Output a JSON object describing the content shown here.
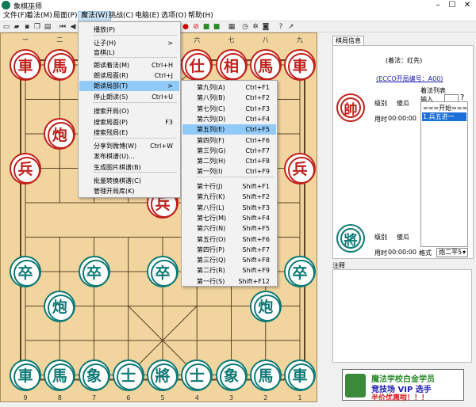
{
  "window": {
    "title": "象棋巫师",
    "btn_min": "–",
    "btn_max": "☐",
    "btn_close": "✕"
  },
  "menubar": [
    "文件(F)",
    "着法(M)",
    "局面(P)",
    "魔法(W)",
    "挑战(C)",
    "电脑(E)",
    "选项(O)",
    "帮助(H)"
  ],
  "board": {
    "col_top": [
      "一",
      "二",
      "三",
      "四",
      "五",
      "六",
      "七",
      "八",
      "九"
    ],
    "col_bottom": [
      "9",
      "8",
      "7",
      "6",
      "5",
      "4",
      "3",
      "2",
      "1"
    ],
    "pieces": [
      {
        "t": "車",
        "s": "red",
        "c": 0,
        "r": 0
      },
      {
        "t": "馬",
        "s": "red",
        "c": 1,
        "r": 0
      },
      {
        "t": "仕",
        "s": "red",
        "c": 5,
        "r": 0
      },
      {
        "t": "相",
        "s": "red",
        "c": 6,
        "r": 0
      },
      {
        "t": "馬",
        "s": "red",
        "c": 7,
        "r": 0
      },
      {
        "t": "車",
        "s": "red",
        "c": 8,
        "r": 0
      },
      {
        "t": "炮",
        "s": "red",
        "c": 1,
        "r": 2
      },
      {
        "t": "兵",
        "s": "red",
        "c": 0,
        "r": 3
      },
      {
        "t": "兵",
        "s": "red",
        "c": 8,
        "r": 3
      },
      {
        "t": "兵",
        "s": "red",
        "c": 4,
        "r": 4
      },
      {
        "t": "卒",
        "s": "grn",
        "c": 0,
        "r": 6
      },
      {
        "t": "卒",
        "s": "grn",
        "c": 2,
        "r": 6
      },
      {
        "t": "卒",
        "s": "grn",
        "c": 4,
        "r": 6
      },
      {
        "t": "卒",
        "s": "grn",
        "c": 8,
        "r": 6
      },
      {
        "t": "炮",
        "s": "grn",
        "c": 1,
        "r": 7
      },
      {
        "t": "炮",
        "s": "grn",
        "c": 7,
        "r": 7
      },
      {
        "t": "車",
        "s": "grn",
        "c": 0,
        "r": 9
      },
      {
        "t": "馬",
        "s": "grn",
        "c": 1,
        "r": 9
      },
      {
        "t": "象",
        "s": "grn",
        "c": 2,
        "r": 9
      },
      {
        "t": "士",
        "s": "grn",
        "c": 3,
        "r": 9
      },
      {
        "t": "將",
        "s": "grn",
        "c": 4,
        "r": 9
      },
      {
        "t": "士",
        "s": "grn",
        "c": 5,
        "r": 9
      },
      {
        "t": "象",
        "s": "grn",
        "c": 6,
        "r": 9
      },
      {
        "t": "馬",
        "s": "grn",
        "c": 7,
        "r": 9
      },
      {
        "t": "車",
        "s": "grn",
        "c": 8,
        "r": 9
      }
    ]
  },
  "magic_menu": {
    "items": [
      {
        "label": "播放(P)",
        "shortcut": ""
      },
      {
        "label": "让子(H)",
        "shortcut": ">"
      },
      {
        "label": "盲棋(L)",
        "shortcut": ""
      },
      {
        "label": "朗读着法(M)",
        "shortcut": "Ctrl+H"
      },
      {
        "label": "朗读局面(R)",
        "shortcut": "Ctrl+J"
      },
      {
        "label": "朗读局部(T)",
        "shortcut": ">"
      },
      {
        "label": "停止朗读(S)",
        "shortcut": "Ctrl+U"
      },
      {
        "label": "搜索开局(O)",
        "shortcut": ""
      },
      {
        "label": "搜索局面(P)",
        "shortcut": "F3"
      },
      {
        "label": "搜索残局(E)",
        "shortcut": ""
      },
      {
        "label": "分享到微博(W)",
        "shortcut": "Ctrl+W"
      },
      {
        "label": "发布棋谱(U)...",
        "shortcut": ""
      },
      {
        "label": "生成图片棋谱(B)",
        "shortcut": ""
      },
      {
        "label": "批量转换棋谱(C)",
        "shortcut": ""
      },
      {
        "label": "管理开局库(K)",
        "shortcut": ""
      }
    ]
  },
  "read_submenu": {
    "items": [
      {
        "label": "第九列(A)",
        "shortcut": "Ctrl+F1"
      },
      {
        "label": "第八列(B)",
        "shortcut": "Ctrl+F2"
      },
      {
        "label": "第七列(C)",
        "shortcut": "Ctrl+F3"
      },
      {
        "label": "第六列(D)",
        "shortcut": "Ctrl+F4"
      },
      {
        "label": "第五列(E)",
        "shortcut": "Ctrl+F5"
      },
      {
        "label": "第四列(F)",
        "shortcut": "Ctrl+F6"
      },
      {
        "label": "第三列(G)",
        "shortcut": "Ctrl+F7"
      },
      {
        "label": "第二列(H)",
        "shortcut": "Ctrl+F8"
      },
      {
        "label": "第一列(I)",
        "shortcut": "Ctrl+F9"
      },
      {
        "label": "第十行(J)",
        "shortcut": "Shift+F1"
      },
      {
        "label": "第九行(K)",
        "shortcut": "Shift+F2"
      },
      {
        "label": "第八行(L)",
        "shortcut": "Shift+F3"
      },
      {
        "label": "第七行(M)",
        "shortcut": "Shift+F4"
      },
      {
        "label": "第六行(N)",
        "shortcut": "Shift+F5"
      },
      {
        "label": "第五行(O)",
        "shortcut": "Shift+F6"
      },
      {
        "label": "第四行(P)",
        "shortcut": "Shift+F7"
      },
      {
        "label": "第三行(Q)",
        "shortcut": "Shift+F8"
      },
      {
        "label": "第二行(R)",
        "shortcut": "Shift+F9"
      },
      {
        "label": "第一行(S)",
        "shortcut": "Shift+F12"
      }
    ]
  },
  "panel": {
    "tab": "棋局信息",
    "first_move": "(着法：红先)",
    "eco": "(ECCO开局编号：A00)",
    "red_piece": "帥",
    "black_piece": "將",
    "level_label": "级别",
    "level_value": "傻瓜",
    "time_label": "用时",
    "time_value": "00:00:00",
    "move_list_title": "着法列表",
    "input_label": "输入",
    "move_items": [
      "===开始===",
      "1.兵五进一"
    ],
    "format_label": "格式",
    "format_value": "炮二平5",
    "notes_label": "注释",
    "ad_line1": "魔法学校白金学员",
    "ad_line2": "竞技场 VIP 选手",
    "ad_line3": "半价优惠啦！！！"
  }
}
